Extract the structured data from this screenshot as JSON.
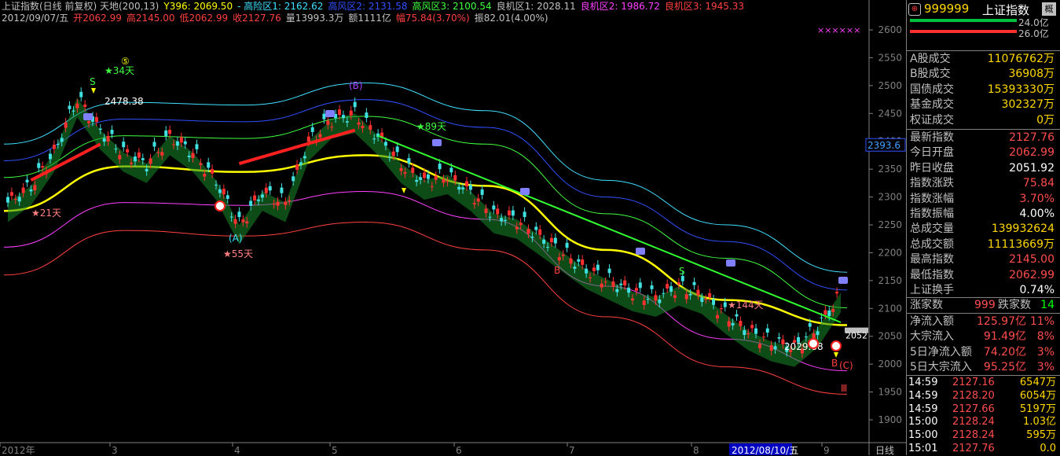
{
  "header": {
    "line1": [
      {
        "text": "上证指数(日线 前复权) 天地(200,13)",
        "color": "#c0c0c0"
      },
      {
        "text": "Y396: 2069.50",
        "color": "#ffff00"
      },
      {
        "text": "- 高险区1: 2162.62",
        "color": "#40e0ff"
      },
      {
        "text": "高风区2: 2131.58",
        "color": "#3050ff"
      },
      {
        "text": "高风区3: 2100.54",
        "color": "#40ff40"
      },
      {
        "text": "良机区1: 2028.11",
        "color": "#c0c0c0"
      },
      {
        "text": "良机区2: 1986.72",
        "color": "#ff40ff"
      },
      {
        "text": "良机区3: 1945.33",
        "color": "#ff4040"
      }
    ],
    "line2": [
      {
        "text": "2012/09/07/五",
        "color": "#c0c0c0"
      },
      {
        "text": "开2062.99",
        "color": "#ff4040"
      },
      {
        "text": "高2145.00",
        "color": "#ff4040"
      },
      {
        "text": "低2062.99",
        "color": "#ff4040"
      },
      {
        "text": "收2127.76",
        "color": "#ff4040"
      },
      {
        "text": "量13993.3万",
        "color": "#c0c0c0"
      },
      {
        "text": "额1111亿",
        "color": "#c0c0c0"
      },
      {
        "text": "幅75.84(3.70%)",
        "color": "#ff4040"
      },
      {
        "text": "振82.01(4.00%)",
        "color": "#c0c0c0"
      }
    ],
    "xxx": "××××××"
  },
  "y_axis": {
    "labels": [
      "2600",
      "2550",
      "2500",
      "2450",
      "2400",
      "2350",
      "2300",
      "2250",
      "2200",
      "2150",
      "2100",
      "2050",
      "2000",
      "1950",
      "1900"
    ],
    "current_marker": "2393.6",
    "last_marker": "2052"
  },
  "x_axis": {
    "labels": [
      "2012年",
      "3",
      "4",
      "5",
      "6",
      "7",
      "8",
      "9"
    ],
    "cursor_date": "2012/08/10/五",
    "period": "日线"
  },
  "annotations": {
    "high_price": "2478.38",
    "low_price": "2029.88",
    "days_21": "★21天",
    "days_34": "★34天",
    "days_55": "★55天",
    "days_89": "★89天",
    "days_144": "★144天",
    "wave_a": "(A)",
    "wave_b": "(B)",
    "wave_c": "(C)",
    "circle5": "⑤",
    "roman3": "Ⅲ",
    "b1": "B",
    "b2": "B",
    "s1": "S",
    "s2": "S"
  },
  "chart_data": {
    "type": "line",
    "title": "上证指数(日线 前复权)",
    "ylim": [
      1880,
      2620
    ],
    "x_months": [
      "2012年",
      "3",
      "4",
      "5",
      "6",
      "7",
      "8",
      "9"
    ],
    "series": [
      {
        "name": "高险区1",
        "values": [
          2395,
          2470,
          2465,
          2505,
          2455,
          2330,
          2250,
          2165
        ],
        "color": "#40e0ff"
      },
      {
        "name": "高风区2",
        "values": [
          2365,
          2440,
          2435,
          2475,
          2425,
          2300,
          2220,
          2133
        ],
        "color": "#3050ff"
      },
      {
        "name": "高风区3",
        "values": [
          2335,
          2410,
          2405,
          2445,
          2395,
          2270,
          2190,
          2101
        ],
        "color": "#40ff40"
      },
      {
        "name": "Y396",
        "values": [
          2275,
          2355,
          2345,
          2375,
          2320,
          2205,
          2115,
          2070
        ],
        "color": "#ffff00"
      },
      {
        "name": "良机区2",
        "values": [
          2210,
          2290,
          2285,
          2310,
          2260,
          2140,
          2045,
          1988
        ],
        "color": "#ff40ff"
      },
      {
        "name": "良机区3",
        "values": [
          2160,
          2240,
          2230,
          2255,
          2205,
          2085,
          1995,
          1946
        ],
        "color": "#ff4040"
      }
    ],
    "price_path": [
      2290,
      2320,
      2380,
      2478,
      2420,
      2380,
      2360,
      2410,
      2380,
      2330,
      2250,
      2310,
      2290,
      2400,
      2440,
      2450,
      2410,
      2360,
      2330,
      2340,
      2310,
      2270,
      2260,
      2230,
      2200,
      2170,
      2150,
      2130,
      2120,
      2140,
      2125,
      2090,
      2060,
      2040,
      2030,
      2065,
      2128
    ]
  },
  "panel": {
    "code": "999999",
    "name": "上证指数",
    "tag": "概",
    "bar1": "24.0亿",
    "bar2": "26.0亿",
    "rows1": [
      {
        "label": "A股成交",
        "value": "11076762万",
        "color": "#ffd800"
      },
      {
        "label": "B股成交",
        "value": "36908万",
        "color": "#ffd800"
      },
      {
        "label": "国债成交",
        "value": "15393330万",
        "color": "#ffd800"
      },
      {
        "label": "基金成交",
        "value": "302327万",
        "color": "#ffd800"
      },
      {
        "label": "权证成交",
        "value": "0万",
        "color": "#ffd800"
      }
    ],
    "rows2": [
      {
        "label": "最新指数",
        "value": "2127.76",
        "color": "#ff4d4d"
      },
      {
        "label": "今日开盘",
        "value": "2062.99",
        "color": "#ff4d4d"
      },
      {
        "label": "昨日收盘",
        "value": "2051.92",
        "color": "#ffffff"
      },
      {
        "label": "指数涨跌",
        "value": "75.84",
        "color": "#ff4d4d"
      },
      {
        "label": "指数涨幅",
        "value": "3.70%",
        "color": "#ff4d4d"
      },
      {
        "label": "指数振幅",
        "value": "4.00%",
        "color": "#ffffff"
      },
      {
        "label": "总成交量",
        "value": "139932624",
        "color": "#ffd800"
      },
      {
        "label": "总成交额",
        "value": "11113669万",
        "color": "#ffd800"
      },
      {
        "label": "最高指数",
        "value": "2145.00",
        "color": "#ff4d4d"
      },
      {
        "label": "最低指数",
        "value": "2062.99",
        "color": "#ff4d4d"
      },
      {
        "label": "上证换手",
        "value": "0.74%",
        "color": "#ffffff"
      }
    ],
    "updown": {
      "up_label": "涨家数",
      "up": "999",
      "down_label": "跌家数",
      "down": "14"
    },
    "flows": [
      {
        "label": "净流入额",
        "value": "125.97亿",
        "pct": "11%"
      },
      {
        "label": "大宗流入",
        "value": "91.49亿",
        "pct": "8%"
      },
      {
        "label": "5日净流入额",
        "value": "74.20亿",
        "pct": "3%"
      },
      {
        "label": "5日大宗流入",
        "value": "95.25亿",
        "pct": "3%"
      }
    ],
    "ticks": [
      {
        "time": "14:59",
        "price": "2127.16",
        "vol": "6547万"
      },
      {
        "time": "14:59",
        "price": "2128.20",
        "vol": "6054万"
      },
      {
        "time": "14:59",
        "price": "2127.66",
        "vol": "5197万"
      },
      {
        "time": "15:00",
        "price": "2128.24",
        "vol": "1.03亿"
      },
      {
        "time": "15:00",
        "price": "2128.24",
        "vol": "595万"
      },
      {
        "time": "15:01",
        "price": "2127.76",
        "vol": "0.0"
      }
    ],
    "close_icon": "close-icon"
  }
}
